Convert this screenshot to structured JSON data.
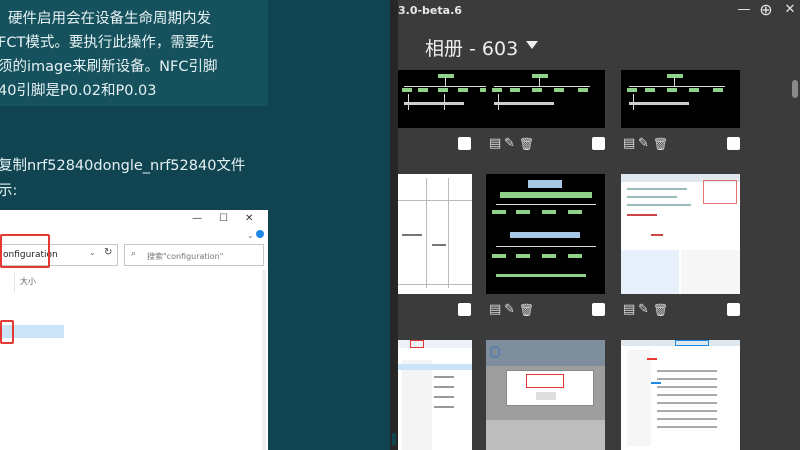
{
  "document": {
    "note_lines": [
      "硬件启用会在设备生命周期内发",
      "FCT模式。要执行此操作，需要先",
      "须的image来刷新设备。NFC引脚",
      "40引脚是P0.02和P0.03"
    ],
    "paragraph_lines": [
      "复制nrf52840dongle_nrf52840文件",
      "示:"
    ],
    "explorer": {
      "window_buttons": [
        "—",
        "☐",
        "✕"
      ],
      "address_value": "onfiguration",
      "search_placeholder": "搜索\"configuration\"",
      "column_header": "大小"
    }
  },
  "app": {
    "version": "3.0-beta.6",
    "toolbar_icons": [
      "minimize-icon",
      "add-circle-icon",
      "close-icon"
    ],
    "toolbar_glyphs": {
      "minimize": "—",
      "add": "⊕",
      "close": "✕"
    },
    "album_title": "相册 - 603",
    "action_glyphs": {
      "details": "▤",
      "edit": "✎",
      "delete": "🗑"
    },
    "thumbnails": [
      {
        "kind": "tree-diagram",
        "checked": false
      },
      {
        "kind": "tree-diagram",
        "checked": false
      },
      {
        "kind": "tree-diagram",
        "checked": false
      },
      {
        "kind": "document-table",
        "checked": false
      },
      {
        "kind": "tree-diagram-large",
        "checked": false
      },
      {
        "kind": "code-editor",
        "checked": false
      },
      {
        "kind": "explorer-window",
        "checked": false
      },
      {
        "kind": "dialog-window",
        "checked": false
      },
      {
        "kind": "file-list",
        "checked": false
      }
    ],
    "colors": {
      "background": "#3b3b3b",
      "checkbox": "#ffffff",
      "tree_node": "#8fd18a"
    }
  }
}
